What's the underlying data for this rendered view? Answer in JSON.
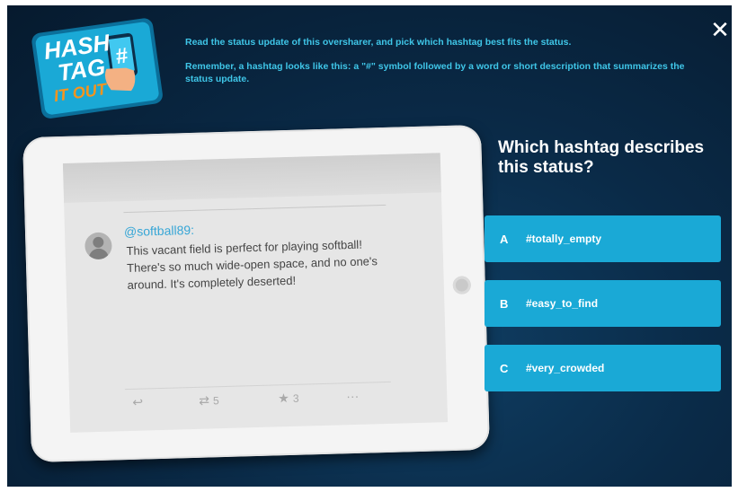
{
  "logo": {
    "line1": "HASH",
    "line2": "TAG",
    "line3": "IT OUT"
  },
  "instructions": {
    "line1": "Read the status update of this oversharer, and pick which hashtag best fits the status.",
    "line2": "Remember, a hashtag looks like this: a \"#\" symbol followed by a word or short description that summarizes the status update."
  },
  "close_label": "✕",
  "tweet": {
    "handle": "@softball89:",
    "text": "This vacant field is perfect for playing softball! There's so much wide-open space, and no one's around. It's completely deserted!",
    "retweet_count": "5",
    "favorite_count": "3",
    "more_label": "···"
  },
  "question": "Which hashtag describes this status?",
  "answers": [
    {
      "letter": "A",
      "text": "#totally_empty"
    },
    {
      "letter": "B",
      "text": "#easy_to_find"
    },
    {
      "letter": "C",
      "text": "#very_crowded"
    }
  ],
  "colors": {
    "background": "#0a2a47",
    "accent": "#1aa9d6",
    "instruction_text": "#3fc6e8",
    "logo_orange": "#f7941d"
  }
}
